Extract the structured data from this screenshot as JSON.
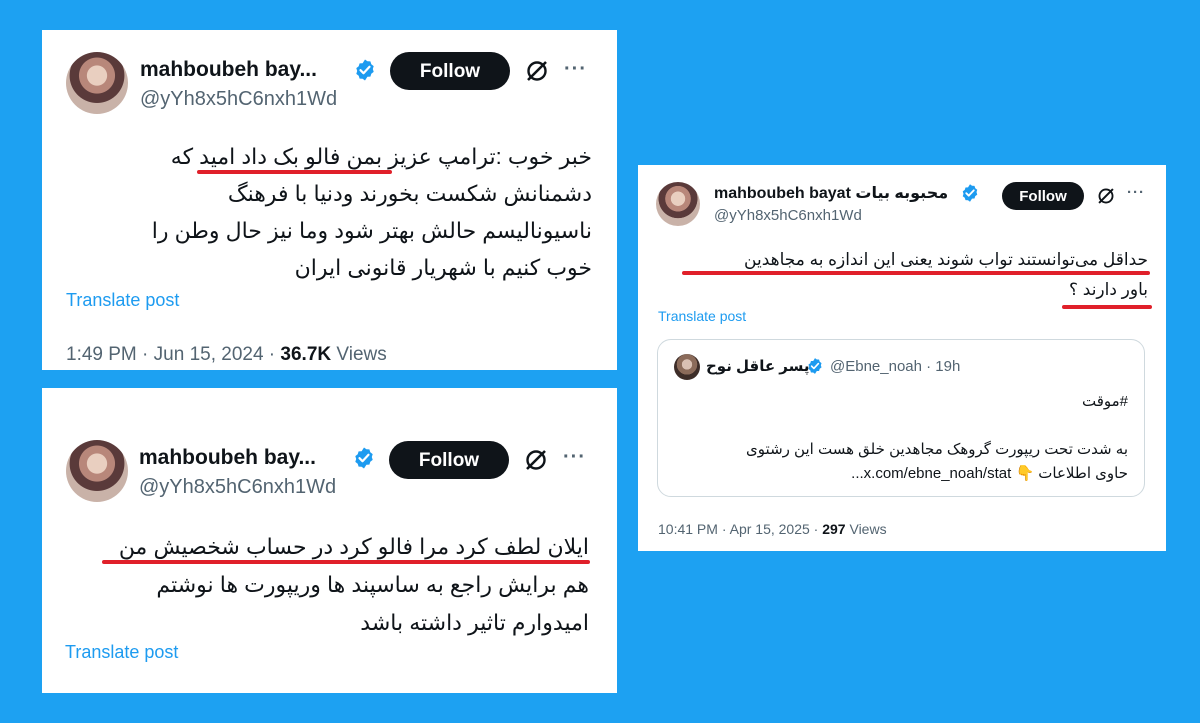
{
  "colors": {
    "background": "#1da1f2",
    "card": "#ffffff",
    "follow_button": "#0f1419",
    "link": "#1d9bf0",
    "verified": "#1d9bf0",
    "underline": "#e0202a",
    "muted": "#536471"
  },
  "tweet1": {
    "name": "mahboubeh bay...",
    "handle": "@yYh8x5hC6nxh1Wd",
    "follow_label": "Follow",
    "more_label": "···",
    "lines": [
      "خبر خوب :ترامپ عزیز بمن فالو بک داد امید که",
      "دشمنانش شکست بخورند ودنیا با فرهنگ",
      "ناسیونالیسم حالش بهتر شود وما نیز حال وطن را",
      "خوب کنیم با شهریار قانونی ایران"
    ],
    "translate_label": "Translate post",
    "time": "1:49 PM",
    "date": "Jun 15, 2024",
    "views_count": "36.7K",
    "views_label": "Views"
  },
  "tweet2": {
    "name": "mahboubeh bay...",
    "handle": "@yYh8x5hC6nxh1Wd",
    "follow_label": "Follow",
    "more_label": "···",
    "lines": [
      "ایلان لطف کرد مرا فالو کرد در حساب شخصیش من",
      "هم برایش راجع به ساسپند ها وریپورت ها نوشتم",
      "امیدوارم تاثیر داشته باشد"
    ],
    "translate_label": "Translate post"
  },
  "tweet3": {
    "name": "mahboubeh bayat محبوبه بیات",
    "handle": "@yYh8x5hC6nxh1Wd",
    "follow_label": "Follow",
    "more_label": "···",
    "lines": [
      "حداقل می‌توانستند تواب شوند یعنی این اندازه به مجاهدین",
      "باور دارند ؟"
    ],
    "translate_label": "Translate post",
    "quote": {
      "name": "پسر عاقل نوح",
      "handle": "@Ebne_noah · 19h",
      "hashtag": "#موقت",
      "line1": "به شدت تحت ریپورت گروهک مجاهدین خلق هست این رشتوی",
      "line2": "حاوی اطلاعات 👇 x.com/ebne_noah/stat..."
    },
    "time": "10:41 PM",
    "date": "Apr 15, 2025",
    "views_count": "297",
    "views_label": "Views"
  }
}
